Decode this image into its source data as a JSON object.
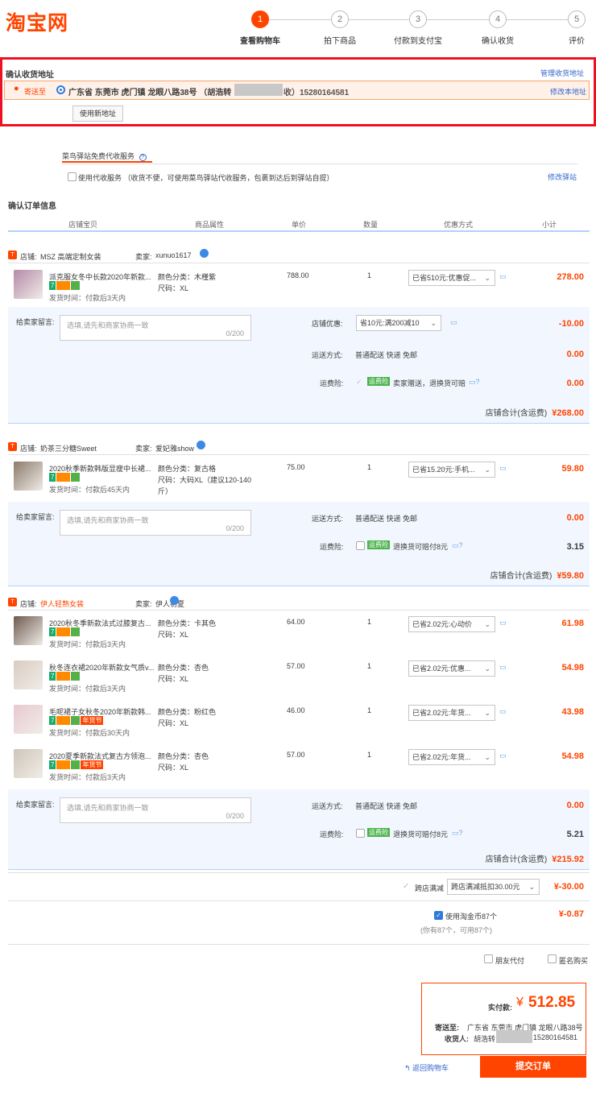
{
  "brand": {
    "logo": "淘宝网"
  },
  "steps": [
    {
      "n": "1",
      "label": "查看购物车"
    },
    {
      "n": "2",
      "label": "拍下商品"
    },
    {
      "n": "3",
      "label": "付款到支付宝"
    },
    {
      "n": "4",
      "label": "确认收货"
    },
    {
      "n": "5",
      "label": "评价"
    }
  ],
  "address": {
    "title": "确认收货地址",
    "manage": "管理收货地址",
    "sendto": "寄送至",
    "addr": "广东省 东莞市 虎门镇 龙眼八路38号 （胡浩转",
    "addr_tail": "收）15280164581",
    "edit": "修改本地址",
    "new_btn": "使用新地址"
  },
  "station": {
    "tab": "菜鸟驿站免费代收服务",
    "help": "?",
    "option": "使用代收服务 （收货不便，可使用菜鸟驿站代收服务，包裹到达后到驿站自提）",
    "modify": "修改驿站"
  },
  "order": {
    "title": "确认订单信息",
    "cols": [
      "店铺宝贝",
      "商品属性",
      "单价",
      "数量",
      "优惠方式",
      "小计"
    ]
  },
  "labels": {
    "shop": "店铺:",
    "seller": "卖家:",
    "msg": "给卖家留言:",
    "msg_placeholder": "选填,请先和商家协商一致",
    "msg_count": "0/200",
    "shop_discount": "店铺优惠:",
    "ship": "运送方式:",
    "ship_val": "普通配送 快递 免邮",
    "ins": "运费险:",
    "ins_tag": "运费险",
    "total": "店铺合计(含运费)"
  },
  "shops": [
    {
      "shop": "MSZ 高端定制女装",
      "seller": "xunuo1617",
      "items": [
        {
          "title": "派克服女冬中长款2020年新款...",
          "attr1": "颜色分类：木槿紫",
          "attr2": "尺码：XL",
          "ship": "发货时间：付款后3天内",
          "price": "788.00",
          "qty": "1",
          "promo": "已省510元:优惠促...",
          "sub": "278.00",
          "tags": [
            "7",
            "card",
            "green"
          ]
        }
      ],
      "discount": "省10元:满200减10",
      "discount_val": "-10.00",
      "ship_fee": "0.00",
      "ins_text": "卖家赠送，退换货可赔",
      "ins_val": "0.00",
      "total": "¥268.00"
    },
    {
      "shop": "奶茶三分糖Sweet",
      "seller": "爱妃雅show",
      "items": [
        {
          "title": "2020秋季新款韩版显瘦中长裙...",
          "attr1": "颜色分类：复古格",
          "attr2": "尺码：大码XL（建议120-140",
          "attr3": "斤）",
          "ship": "发货时间：付款后45天内",
          "price": "75.00",
          "qty": "1",
          "promo": "已省15.20元:手机...",
          "sub": "59.80",
          "tags": [
            "7",
            "card",
            "green"
          ]
        }
      ],
      "ship_fee": "0.00",
      "ins_text": "退换货可赔付8元",
      "ins_val": "3.15",
      "total": "¥59.80"
    },
    {
      "shop": "伊人轻熟女装",
      "seller": "伊人初夏",
      "items": [
        {
          "title": "2020秋冬季新款法式过膝复古...",
          "attr1": "颜色分类：卡其色",
          "attr2": "尺码：XL",
          "ship": "发货时间：付款后3天内",
          "price": "64.00",
          "qty": "1",
          "promo": "已省2.02元:心动价",
          "sub": "61.98",
          "tags": [
            "7",
            "card",
            "green"
          ]
        },
        {
          "title": "秋冬连衣裙2020年新款女气质v...",
          "attr1": "颜色分类：杏色",
          "attr2": "尺码：XL",
          "ship": "发货时间：付款后3天内",
          "price": "57.00",
          "qty": "1",
          "promo": "已省2.02元:优惠...",
          "sub": "54.98",
          "tags": [
            "7",
            "card",
            "green"
          ]
        },
        {
          "title": "毛呢裙子女秋冬2020年新款韩...",
          "attr1": "颜色分类：粉红色",
          "attr2": "尺码：XL",
          "ship": "发货时间：付款后30天内",
          "price": "46.00",
          "qty": "1",
          "promo": "已省2.02元:年货...",
          "sub": "43.98",
          "tags": [
            "7",
            "card",
            "green",
            "年货节"
          ]
        },
        {
          "title": "2020夏季新款法式复古方领泡...",
          "attr1": "颜色分类：杏色",
          "attr2": "尺码：XL",
          "ship": "发货时间：付款后3天内",
          "price": "57.00",
          "qty": "1",
          "promo": "已省2.02元:年货...",
          "sub": "54.98",
          "tags": [
            "7",
            "card",
            "green",
            "年货节"
          ]
        }
      ],
      "ship_fee": "0.00",
      "ins_text": "退换货可赔付8元",
      "ins_val": "5.21",
      "total": "¥215.92"
    }
  ],
  "cross": {
    "label": "跨店满减",
    "select": "跨店满减抵扣30.00元",
    "val": "¥-30.00"
  },
  "coin": {
    "label": "使用淘金币87个",
    "note": "(你有87个，可用87个)",
    "val": "¥-0.87"
  },
  "opts": {
    "friend": "朋友代付",
    "anon": "匿名购买"
  },
  "summary": {
    "pay_label": "实付款:",
    "yen": "¥",
    "amount": "512.85",
    "sendto_label": "寄送至:",
    "sendto": "广东省 东莞市 虎门镇 龙眼八路38号",
    "recv_label": "收货人:",
    "recv": "胡浩转",
    "phone": "15280164581"
  },
  "footer": {
    "back": "返回购物车",
    "submit": "提交订单"
  }
}
